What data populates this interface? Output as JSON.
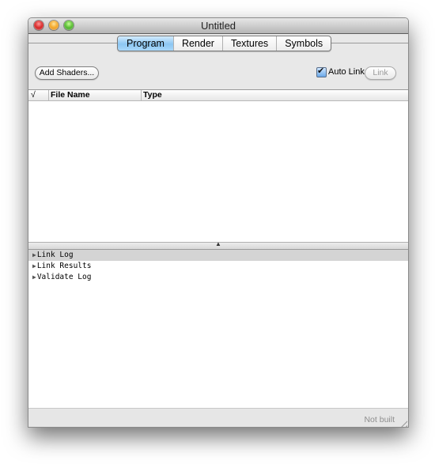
{
  "window": {
    "title": "Untitled"
  },
  "tabs": [
    {
      "label": "Program",
      "active": true
    },
    {
      "label": "Render",
      "active": false
    },
    {
      "label": "Textures",
      "active": false
    },
    {
      "label": "Symbols",
      "active": false
    }
  ],
  "toolbar": {
    "add_shaders_label": "Add Shaders...",
    "auto_link_label": "Auto Link",
    "auto_link_checked": true,
    "link_label": "Link"
  },
  "table": {
    "columns": [
      "√",
      "File Name",
      "Type"
    ],
    "rows": []
  },
  "splitter": {
    "grip_icon": "splitter-grip-icon"
  },
  "logs": [
    {
      "label": "Link Log",
      "selected": true
    },
    {
      "label": "Link Results",
      "selected": false
    },
    {
      "label": "Validate Log",
      "selected": false
    }
  ],
  "status": {
    "text": "Not built"
  }
}
